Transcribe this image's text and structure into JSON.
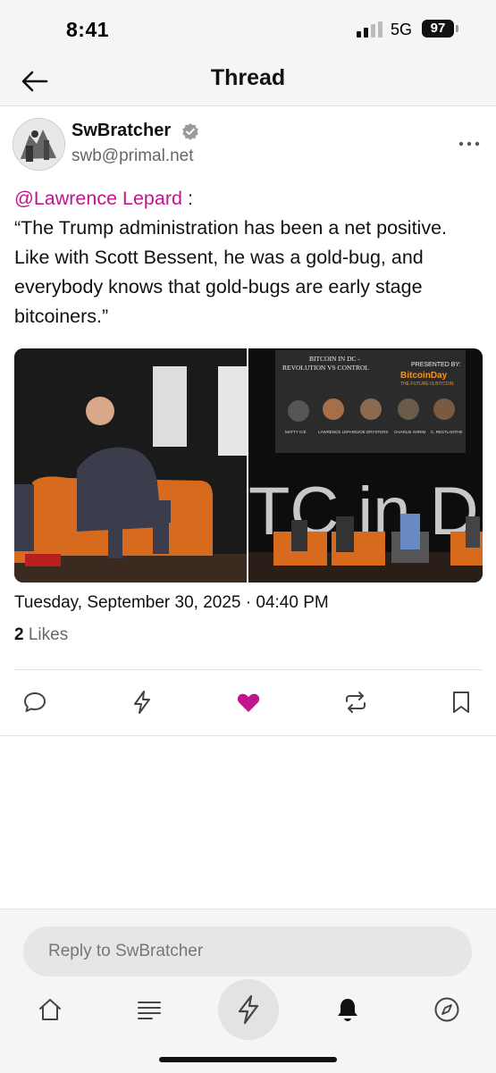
{
  "status_bar": {
    "time": "8:41",
    "network": "5G",
    "battery": "97"
  },
  "header": {
    "title": "Thread"
  },
  "post": {
    "author_name": "SwBratcher",
    "author_handle": "swb@primal.net",
    "mention": "@Lawrence Lepard",
    "mention_suffix": " :",
    "body": "“The Trump administration has been a net positive. Like with Scott Bessent, he was a gold-bug, and everybody knows that gold-bugs are early stage bitcoiners.”",
    "timestamp": "Tuesday, September 30, 2025 · 04:40 PM",
    "likes_count": "2",
    "likes_label": "Likes"
  },
  "media": {
    "banner_line1": "BITCOIN IN DC -",
    "banner_line2": "REVOLUTION VS CONTROL",
    "presented_by": "PRESENTED BY:",
    "sponsor": "BitcoinDay",
    "sponsor_tagline": "THE FUTURE IS BITCOIN",
    "speakers": [
      "MATTY ICE",
      "LAWRENCE LEPARD",
      "JOE DRYSTERS",
      "CHARLIE SHRIM",
      "C. RESTLANTHE"
    ],
    "stage_text": "TC in D"
  },
  "reply": {
    "placeholder": "Reply to SwBratcher"
  },
  "colors": {
    "accent": "#c0168a",
    "muted": "#666666",
    "background": "#f5f5f5"
  },
  "icons": {
    "actions": [
      "reply-icon",
      "zap-icon",
      "like-icon",
      "repost-icon",
      "bookmark-icon"
    ],
    "nav": [
      "home-icon",
      "feed-icon",
      "zap-icon",
      "notifications-icon",
      "explore-icon"
    ]
  }
}
